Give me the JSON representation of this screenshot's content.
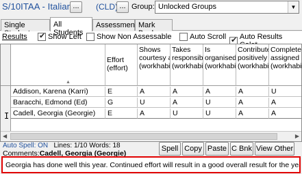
{
  "header": {
    "class_title": "S/10ITAA - Italian",
    "cld_label": "(CLD)",
    "ellipsis": "...",
    "group_label": "Group:",
    "group_value": "Unlocked Groups"
  },
  "tabs": [
    {
      "label": "Single Student"
    },
    {
      "label": "All Students"
    },
    {
      "label": "Assessment"
    },
    {
      "label": "Mark Book"
    }
  ],
  "options": {
    "results_label": "Results",
    "show_left": "Show Left",
    "show_non_assessable": "Show Non Assessable",
    "auto_scroll": "Auto Scroll",
    "auto_results_calc": "Auto Results Calc*"
  },
  "grid": {
    "columns": [
      {
        "line1": "Effort",
        "line2": "(effort)"
      },
      {
        "line1": "Shows",
        "line2": "courtesy a",
        "line3": "(workhabit"
      },
      {
        "line1": "Takes",
        "line2": "responsibi",
        "line3": "(workhabit"
      },
      {
        "line1": "Is",
        "line2": "organised",
        "line3": "(workhabit"
      },
      {
        "line1": "Contribute",
        "line2": "positively",
        "line3": "(workhabit"
      },
      {
        "line1": "Completes",
        "line2": "assigned t",
        "line3": "(workhabit"
      }
    ],
    "rows": [
      {
        "name": "Addison, Karena (Karri)",
        "values": [
          "E",
          "A",
          "A",
          "A",
          "A",
          "U"
        ]
      },
      {
        "name": "Baracchi, Edmond (Ed)",
        "values": [
          "G",
          "U",
          "A",
          "U",
          "A",
          "A"
        ]
      },
      {
        "name": "Cadell, Georgia (Georgie)",
        "values": [
          "E",
          "A",
          "U",
          "U",
          "A",
          "A"
        ]
      }
    ]
  },
  "status": {
    "auto_spell": "Auto Spell: ON",
    "lines": "Lines: 1/10",
    "words": "Words:  18"
  },
  "comments": {
    "label": "Comments:",
    "student": "Cadell, Georgia (Georgie)",
    "text": "Georgia has done well this year. Continued effort will result in a good overall result for the year."
  },
  "buttons": {
    "spell": "Spell",
    "copy": "Copy",
    "paste": "Paste",
    "cbnk": "C Bnk",
    "view_other": "View Other"
  },
  "colors": {
    "title_blue": "#1e4f9c",
    "highlight_border": "#e00000"
  }
}
